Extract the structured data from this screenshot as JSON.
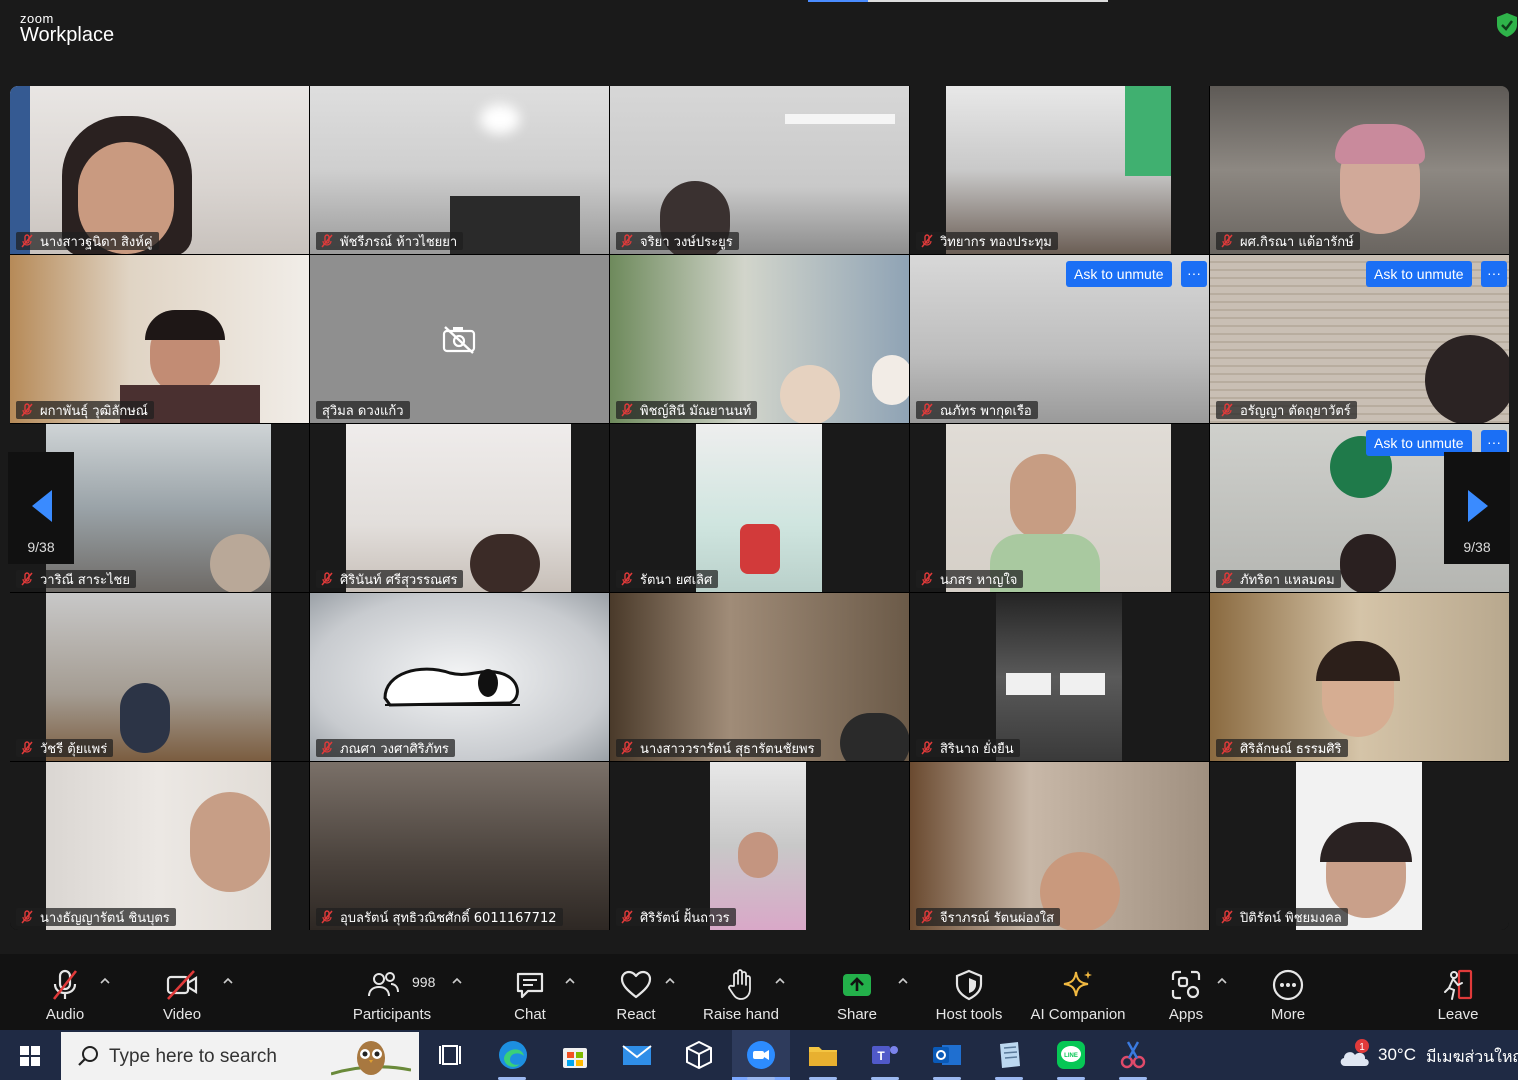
{
  "window": {
    "brand_top": "zoom",
    "brand_main": "Workplace"
  },
  "ask_to_unmute": "Ask to unmute",
  "more_dots": "···",
  "pager": {
    "left_count": "9/38",
    "right_count": "9/38"
  },
  "participants": [
    {
      "name": "นางสาวฐนิดา สิงห์คู่"
    },
    {
      "name": "พัชรีภรณ์ ห้าวไชยยา"
    },
    {
      "name": "จริยา วงษ์ประยูร"
    },
    {
      "name": "วิทยากร ทองประทุม"
    },
    {
      "name": "ผศ.กิรณา แต้อารักษ์"
    },
    {
      "name": "ผกาพันธุ์ วุฒิลักษณ์"
    },
    {
      "name": "สุวิมล ดวงแก้ว"
    },
    {
      "name": "พิชญ์สินี มัณยานนท์"
    },
    {
      "name": "ณภัทร พากุดเรือ"
    },
    {
      "name": "อรัญญา ตัดถุยาวัตร์"
    },
    {
      "name": "วาริณี สาระไชย"
    },
    {
      "name": "ศิรินันท์ ศรีสุวรรณศร"
    },
    {
      "name": "รัตนา ยศเลิศ"
    },
    {
      "name": "นภสร หาญใจ"
    },
    {
      "name": "ภัทริดา แหลมคม"
    },
    {
      "name": "วัชรี ตุ้ยแพร่"
    },
    {
      "name": "ภณศา วงศาศิริภัทร"
    },
    {
      "name": "นางสาววรารัตน์ สุธารัตนชัยพร"
    },
    {
      "name": "สิรินาถ ยั่งยืน"
    },
    {
      "name": "ศิริลักษณ์ ธรรมศิริ"
    },
    {
      "name": "นางธัญญารัตน์ ชินบุตร"
    },
    {
      "name": "อุบลรัตน์ สุทธิวณิชศักดิ์ 6011167712"
    },
    {
      "name": "ศิริรัตน์ ฝั้นถาวร"
    },
    {
      "name": "จีราภรณ์ รัตนผ่องใส"
    },
    {
      "name": "ปิติรัตน์ พิชยมงคล"
    }
  ],
  "toolbar": {
    "audio": "Audio",
    "video": "Video",
    "participants": "Participants",
    "participants_count": "998",
    "chat": "Chat",
    "react": "React",
    "raise_hand": "Raise hand",
    "share": "Share",
    "host_tools": "Host tools",
    "ai_companion": "AI Companion",
    "apps": "Apps",
    "more": "More",
    "leave": "Leave"
  },
  "taskbar": {
    "search_placeholder": "Type here to search",
    "temperature": "30°C",
    "location": "มีเมฆส่วนใหญ่",
    "weather_badge": "1"
  },
  "colors": {
    "accent": "#1b6ff5",
    "share_green": "#23b04a",
    "muted_red": "#e03a3a"
  }
}
